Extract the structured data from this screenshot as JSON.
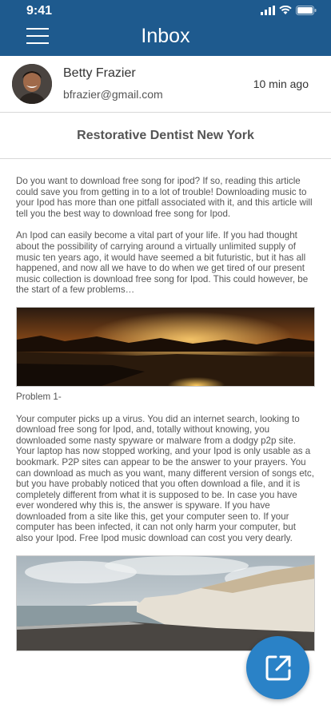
{
  "status_bar": {
    "time": "9:41"
  },
  "header": {
    "title": "Inbox",
    "menu_icon": "hamburger-menu-icon"
  },
  "sender": {
    "name": "Betty Frazier",
    "email": "bfrazier@gmail.com",
    "time_ago": "10 min ago"
  },
  "message": {
    "subject": "Restorative Dentist New York",
    "paragraphs": [
      "Do you want to download free song for ipod? If so, reading this article could save you from getting in to a lot of trouble! Downloading music to your Ipod has more than one pitfall associated with it, and this article will tell you the best way to download free song for Ipod.",
      "An Ipod can easily become a vital part of your life. If you had thought about the possibility of carrying around a virtually unlimited supply of music ten years ago, it would have seemed a bit futuristic, but it has all happened, and now all we have to do when we get tired of our present music collection is download free song for Ipod. This could however, be the start of a few problems…"
    ],
    "caption": "Problem 1-",
    "paragraph_3": "Your computer picks up a virus. You did an internet search, looking to download free song for Ipod, and, totally without knowing, you downloaded some nasty spyware or malware from a dodgy p2p site. Your laptop has now stopped working, and your Ipod is only usable as a bookmark. P2P sites can appear to be the answer to your prayers. You can download as much as you want, many different version of songs etc, but you have probably noticed that you often download a file, and it is completely different from what it is supposed to be. In case you have ever wondered why this is, the answer is spyware. If you have downloaded from a site like this, get your computer seen to. If your computer has been infected, it can not only harm your computer, but also your Ipod. Free Ipod music download can cost you very dearly."
  },
  "fab": {
    "icon": "open-external-icon"
  },
  "colors": {
    "header": "#1e5a8e",
    "fab": "#2a82c7"
  }
}
